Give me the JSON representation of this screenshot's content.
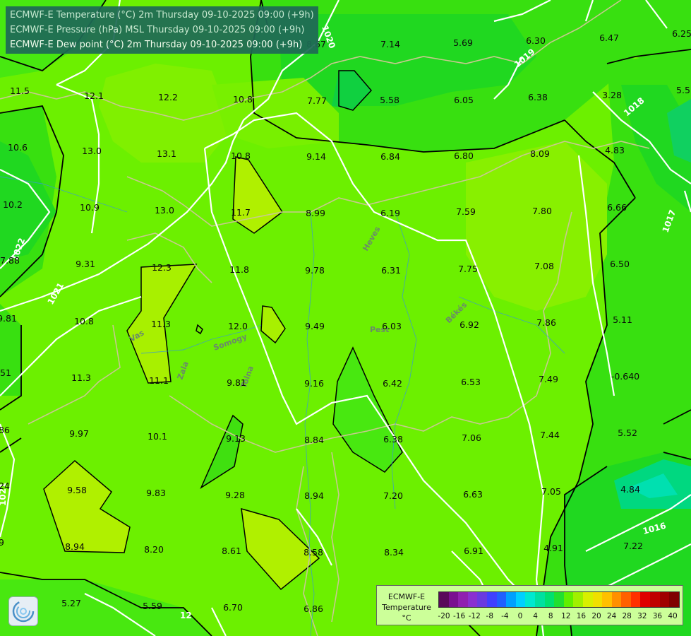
{
  "titles": [
    "ECMWF-E Temperature (°C) 2m Thursday 09-10-2025 09:00 (+9h)",
    "ECMWF-E Pressure (hPa) MSL Thursday 09-10-2025 09:00 (+9h)",
    "ECMWF-E Dew point (°C) 2m Thursday 09-10-2025 09:00 (+9h)"
  ],
  "legend": {
    "line1": "ECMWF-E",
    "line2": "Temperature",
    "line3": "°C",
    "ticks": [
      "-20",
      "-16",
      "-12",
      "-8",
      "-4",
      "0",
      "4",
      "8",
      "12",
      "16",
      "20",
      "24",
      "28",
      "32",
      "36",
      "40"
    ]
  },
  "colors": {
    "scale": [
      "#5a0a5a",
      "#7a1090",
      "#9020b0",
      "#8a30d0",
      "#6a3ae0",
      "#4040ff",
      "#2060ff",
      "#00a0ff",
      "#00d0ff",
      "#00e8d0",
      "#00e0a0",
      "#00e070",
      "#20e030",
      "#60f000",
      "#a0f000",
      "#d8f000",
      "#f0e000",
      "#ffc000",
      "#ff9000",
      "#ff6000",
      "#ff3000",
      "#e00000",
      "#c00000",
      "#a00000",
      "#800000"
    ],
    "field_base": "#6cf000",
    "field_light": "#a8f000",
    "field_mid": "#30e818",
    "field_dark": "#10d040"
  },
  "icons": {
    "logo": "ecmwf-swirl-logo"
  },
  "values": [
    {
      "t": "8.67"
    },
    {
      "t": "7.14"
    },
    {
      "t": "5.69"
    },
    {
      "t": "6.30"
    },
    {
      "t": "6.47"
    },
    {
      "t": "6.25"
    },
    {
      "t": "11.5"
    },
    {
      "t": "12.1"
    },
    {
      "t": "12.2"
    },
    {
      "t": "10.8"
    },
    {
      "t": "7.77"
    },
    {
      "t": "5.58"
    },
    {
      "t": "6.05"
    },
    {
      "t": "6.38"
    },
    {
      "t": "3.28"
    },
    {
      "t": "5.5"
    },
    {
      "t": "10.6"
    },
    {
      "t": "13.0"
    },
    {
      "t": "13.1"
    },
    {
      "t": "10.8"
    },
    {
      "t": "9.14"
    },
    {
      "t": "6.84"
    },
    {
      "t": "6.80"
    },
    {
      "t": "8.09"
    },
    {
      "t": "4.83"
    },
    {
      "t": "10.2"
    },
    {
      "t": "10.9"
    },
    {
      "t": "13.0"
    },
    {
      "t": "11.7"
    },
    {
      "t": "8.99"
    },
    {
      "t": "6.19"
    },
    {
      "t": "7.59"
    },
    {
      "t": "7.80"
    },
    {
      "t": "6.66"
    },
    {
      "t": "7.88"
    },
    {
      "t": "9.31"
    },
    {
      "t": "12.3"
    },
    {
      "t": "11.8"
    },
    {
      "t": "9.78"
    },
    {
      "t": "6.31"
    },
    {
      "t": "7.75"
    },
    {
      "t": "7.08"
    },
    {
      "t": "6.50"
    },
    {
      "t": "9.81"
    },
    {
      "t": "10.8"
    },
    {
      "t": "11.3"
    },
    {
      "t": "12.0"
    },
    {
      "t": "9.49"
    },
    {
      "t": "6.03"
    },
    {
      "t": "6.92"
    },
    {
      "t": "7.86"
    },
    {
      "t": "5.11"
    },
    {
      "t": "11.3"
    },
    {
      "t": "11.1"
    },
    {
      "t": "9.81"
    },
    {
      "t": "9.16"
    },
    {
      "t": "6.42"
    },
    {
      "t": "6.53"
    },
    {
      "t": "7.49"
    },
    {
      "t": "-0.640"
    },
    {
      "t": "9.97"
    },
    {
      "t": "10.1"
    },
    {
      "t": "9.13"
    },
    {
      "t": "8.84"
    },
    {
      "t": "6.38"
    },
    {
      "t": "7.06"
    },
    {
      "t": "7.44"
    },
    {
      "t": "5.52"
    },
    {
      "t": "9.58"
    },
    {
      "t": "9.83"
    },
    {
      "t": "9.28"
    },
    {
      "t": "8.94"
    },
    {
      "t": "7.20"
    },
    {
      "t": "6.63"
    },
    {
      "t": "7.05"
    },
    {
      "t": "4.84"
    },
    {
      "t": "8.94"
    },
    {
      "t": "8.20"
    },
    {
      "t": "8.61"
    },
    {
      "t": "8.58"
    },
    {
      "t": "8.34"
    },
    {
      "t": "6.91"
    },
    {
      "t": "4.91"
    },
    {
      "t": "7.22"
    },
    {
      "t": "5.27"
    },
    {
      "t": "5.59"
    },
    {
      "t": "6.70"
    },
    {
      "t": "6.86"
    },
    {
      "t": "51"
    },
    {
      "t": "86"
    },
    {
      "t": "24"
    },
    {
      "t": "9"
    }
  ],
  "isobars": [
    {
      "label": "1020"
    },
    {
      "label": "1019"
    },
    {
      "label": "1018"
    },
    {
      "label": "1017"
    },
    {
      "label": "1022"
    },
    {
      "label": "1021"
    },
    {
      "label": "1021"
    },
    {
      "label": "1016"
    },
    {
      "label": "12"
    }
  ],
  "cities": [
    {
      "name": "Heves"
    },
    {
      "name": "Pest"
    },
    {
      "name": "Békés"
    },
    {
      "name": "Vas"
    },
    {
      "name": "Zala"
    },
    {
      "name": "Somogy"
    },
    {
      "name": "Tolna"
    }
  ]
}
